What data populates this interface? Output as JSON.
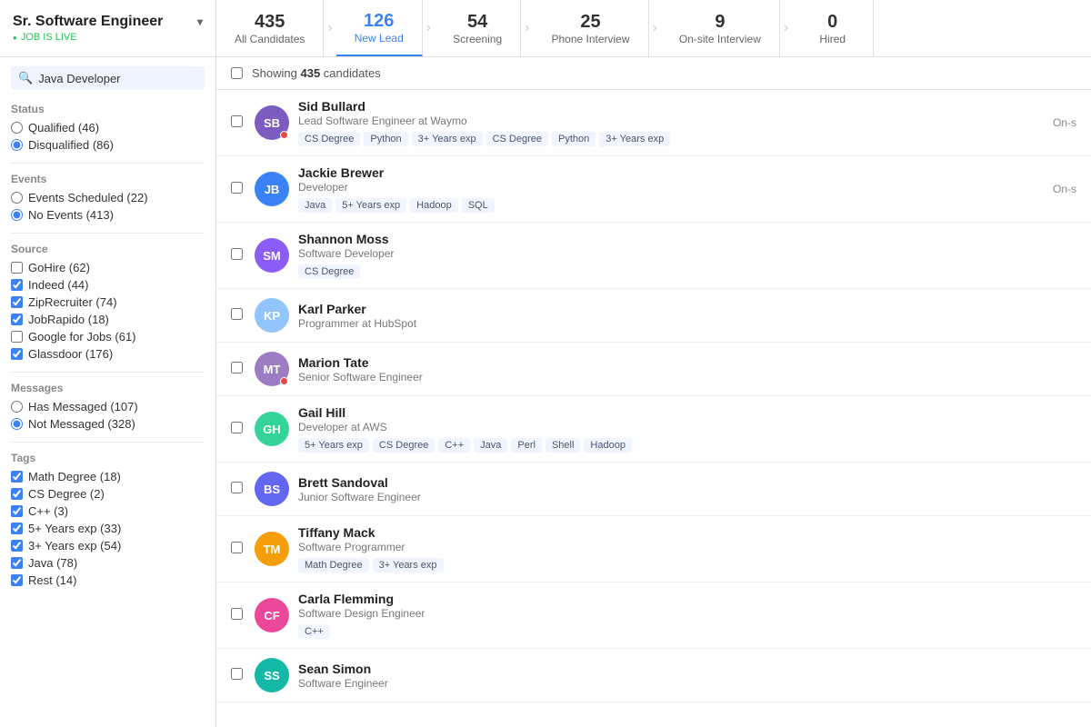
{
  "header": {
    "job_title": "Sr. Software Engineer",
    "job_status": "JOB IS LIVE",
    "chevron": "▾"
  },
  "pipeline": {
    "tabs": [
      {
        "id": "all",
        "count": "435",
        "label": "All Candidates",
        "active": false
      },
      {
        "id": "new-lead",
        "count": "126",
        "label": "New Lead",
        "active": true
      },
      {
        "id": "screening",
        "count": "54",
        "label": "Screening",
        "active": false
      },
      {
        "id": "phone-interview",
        "count": "25",
        "label": "Phone Interview",
        "active": false
      },
      {
        "id": "onsite-interview",
        "count": "9",
        "label": "On-site Interview",
        "active": false
      },
      {
        "id": "hired",
        "count": "0",
        "label": "Hired",
        "active": false
      }
    ]
  },
  "sidebar": {
    "search_placeholder": "Java Developer",
    "search_value": "Java Developer",
    "sections": [
      {
        "label": "Status",
        "options": [
          {
            "type": "radio",
            "label": "Qualified (46)",
            "checked": false
          },
          {
            "type": "radio",
            "label": "Disqualified (86)",
            "checked": true
          }
        ]
      },
      {
        "label": "Events",
        "options": [
          {
            "type": "radio",
            "label": "Events Scheduled (22)",
            "checked": false
          },
          {
            "type": "radio",
            "label": "No Events (413)",
            "checked": true
          }
        ]
      },
      {
        "label": "Source",
        "options": [
          {
            "type": "checkbox",
            "label": "GoHire (62)",
            "checked": false
          },
          {
            "type": "checkbox",
            "label": "Indeed (44)",
            "checked": true
          },
          {
            "type": "checkbox",
            "label": "ZipRecruiter (74)",
            "checked": true
          },
          {
            "type": "checkbox",
            "label": "JobRapido (18)",
            "checked": true
          },
          {
            "type": "checkbox",
            "label": "Google for Jobs (61)",
            "checked": false
          },
          {
            "type": "checkbox",
            "label": "Glassdoor (176)",
            "checked": true
          }
        ]
      },
      {
        "label": "Messages",
        "options": [
          {
            "type": "radio",
            "label": "Has Messaged (107)",
            "checked": false
          },
          {
            "type": "radio",
            "label": "Not Messaged (328)",
            "checked": true
          }
        ]
      },
      {
        "label": "Tags",
        "options": [
          {
            "type": "checkbox",
            "label": "Math Degree (18)",
            "checked": true
          },
          {
            "type": "checkbox",
            "label": "CS Degree (2)",
            "checked": true
          },
          {
            "type": "checkbox",
            "label": "C++ (3)",
            "checked": true
          },
          {
            "type": "checkbox",
            "label": "5+ Years exp (33)",
            "checked": true
          },
          {
            "type": "checkbox",
            "label": "3+ Years exp (54)",
            "checked": true
          },
          {
            "type": "checkbox",
            "label": "Java (78)",
            "checked": true
          },
          {
            "type": "checkbox",
            "label": "Rest (14)",
            "checked": true
          }
        ]
      }
    ]
  },
  "candidates_header": {
    "showing_text": "Showing ",
    "count": "435",
    "suffix": " candidates"
  },
  "candidates": [
    {
      "id": 1,
      "name": "Sid Bullard",
      "title": "Lead Software Engineer at Waymo",
      "initials": "SB",
      "avatar_color": "#8b5cf6",
      "has_photo": true,
      "photo_bg": "#6d4c9e",
      "online": true,
      "stage": "On-s",
      "tags": [
        "CS Degree",
        "Python",
        "3+ Years exp",
        "CS Degree",
        "Python",
        "3+ Years exp"
      ]
    },
    {
      "id": 2,
      "name": "Jackie Brewer",
      "title": "Developer",
      "initials": "JB",
      "avatar_color": "#3b82f6",
      "has_photo": false,
      "online": false,
      "stage": "On-s",
      "tags": [
        "Java",
        "5+ Years exp",
        "Hadoop",
        "SQL"
      ]
    },
    {
      "id": 3,
      "name": "Shannon Moss",
      "title": "Software Developer",
      "initials": "SM",
      "avatar_color": "#8b5cf6",
      "has_photo": false,
      "online": false,
      "stage": "",
      "tags": [
        "CS Degree"
      ]
    },
    {
      "id": 4,
      "name": "Karl Parker",
      "title": "Programmer at HubSpot",
      "initials": "KP",
      "avatar_color": "#60a5fa",
      "has_photo": false,
      "online": false,
      "stage": "",
      "tags": []
    },
    {
      "id": 5,
      "name": "Marion Tate",
      "title": "Senior Software Engineer",
      "initials": "MT",
      "avatar_color": "#a78bfa",
      "has_photo": true,
      "photo_bg": "#7c5cbf",
      "online": true,
      "stage": "",
      "tags": []
    },
    {
      "id": 6,
      "name": "Gail Hill",
      "title": "Developer at AWS",
      "initials": "GH",
      "avatar_color": "#34d399",
      "has_photo": false,
      "online": false,
      "stage": "",
      "tags": [
        "5+ Years exp",
        "CS Degree",
        "C++",
        "Java",
        "Perl",
        "Shell",
        "Hadoop"
      ]
    },
    {
      "id": 7,
      "name": "Brett Sandoval",
      "title": "Junior Software Engineer",
      "initials": "BS",
      "avatar_color": "#6366f1",
      "has_photo": true,
      "photo_bg": "#4a4c8c",
      "online": false,
      "stage": "",
      "tags": []
    },
    {
      "id": 8,
      "name": "Tiffany Mack",
      "title": "Software Programmer",
      "initials": "TM",
      "avatar_color": "#f59e0b",
      "has_photo": false,
      "online": false,
      "stage": "",
      "tags": [
        "Math Degree",
        "3+ Years exp"
      ]
    },
    {
      "id": 9,
      "name": "Carla Flemming",
      "title": "Software Design Engineer",
      "initials": "CF",
      "avatar_color": "#ec4899",
      "has_photo": false,
      "online": false,
      "stage": "",
      "tags": [
        "C++"
      ]
    },
    {
      "id": 10,
      "name": "Sean Simon",
      "title": "Software Engineer",
      "initials": "SS",
      "avatar_color": "#14b8a6",
      "has_photo": false,
      "online": false,
      "stage": "",
      "tags": []
    }
  ]
}
